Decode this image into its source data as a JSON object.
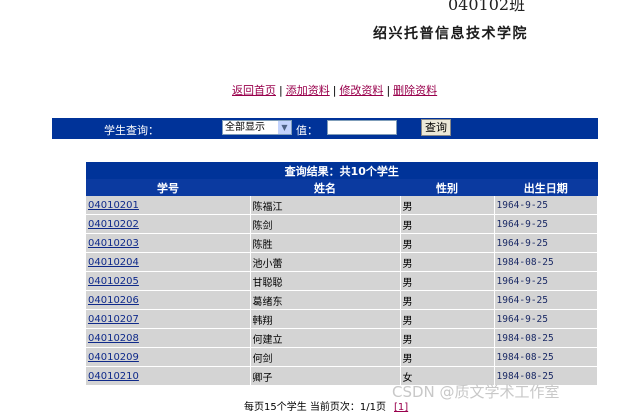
{
  "header": {
    "class_title": "040102班",
    "school": "绍兴托普信息技术学院"
  },
  "nav": {
    "items": [
      "返回首页",
      "添加资料",
      "修改资料",
      "删除资料"
    ],
    "separator": "|"
  },
  "search": {
    "label": "学生查询：",
    "select_value": "全部显示",
    "value_label": "值：",
    "value_input": "",
    "button": "查询"
  },
  "results": {
    "caption": "查询结果：共10个学生",
    "columns": [
      "学号",
      "姓名",
      "性别",
      "出生日期"
    ],
    "rows": [
      [
        "04010201",
        "陈福江",
        "男",
        "1964-9-25"
      ],
      [
        "04010202",
        "陈剑",
        "男",
        "1964-9-25"
      ],
      [
        "04010203",
        "陈胜",
        "男",
        "1964-9-25"
      ],
      [
        "04010204",
        "池小蕾",
        "男",
        "1984-08-25"
      ],
      [
        "04010205",
        "甘聪聪",
        "男",
        "1964-9-25"
      ],
      [
        "04010206",
        "葛绪东",
        "男",
        "1964-9-25"
      ],
      [
        "04010207",
        "韩翔",
        "男",
        "1964-9-25"
      ],
      [
        "04010208",
        "何建立",
        "男",
        "1984-08-25"
      ],
      [
        "04010209",
        "何剑",
        "男",
        "1984-08-25"
      ],
      [
        "04010210",
        "卿子",
        "女",
        "1984-08-25"
      ]
    ]
  },
  "footer": {
    "text": "每页15个学生 当前页次：1/1页",
    "page_link": "[1]"
  },
  "watermark": "CSDN @质文学术工作室",
  "colors": {
    "bar": "#003399",
    "row_bg": "#d4d4d4",
    "link": "#99004c"
  }
}
